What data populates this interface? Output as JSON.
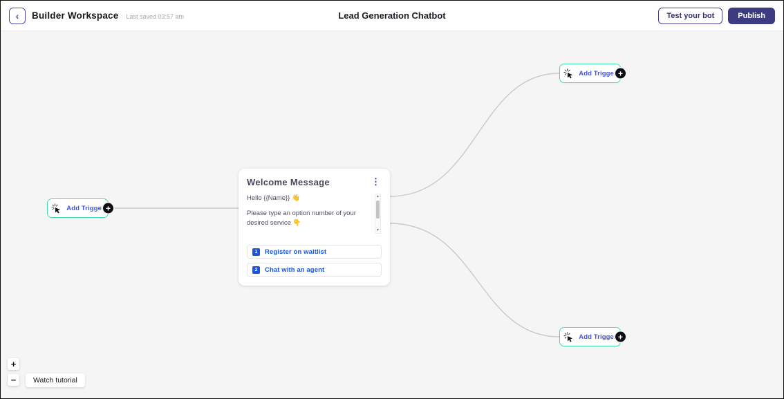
{
  "header": {
    "back_glyph": "‹",
    "title": "Builder Workspace",
    "last_saved": "Last saved 03:57 am",
    "center_title": "Lead Generation Chatbot",
    "test_button": "Test your bot",
    "publish_button": "Publish"
  },
  "canvas": {
    "plus_glyph": "+",
    "triggers": [
      {
        "label": "Add Trigger"
      },
      {
        "label": "Add Trigger"
      },
      {
        "label": "Add Trigger"
      }
    ]
  },
  "welcome_card": {
    "title": "Welcome Message",
    "menu_glyph": "⋮",
    "messages": [
      "Hello {{Name}} 👋",
      "Please type an option number of your desired service 👇"
    ],
    "scroll_up_glyph": "▲",
    "scroll_down_glyph": "▼",
    "options": [
      {
        "number": "1",
        "label": "Register on waitlist"
      },
      {
        "number": "2",
        "label": "Chat with an agent"
      }
    ]
  },
  "controls": {
    "zoom_in": "+",
    "zoom_out": "−",
    "watch_tutorial": "Watch tutorial"
  },
  "colors": {
    "accent_indigo": "#3d3c80",
    "trigger_border": "#3fe2af",
    "trigger_text": "#4355e8",
    "option_blue": "#1a56db",
    "edge_gray": "#c9c9cb",
    "canvas_bg": "#f5f5f6"
  }
}
